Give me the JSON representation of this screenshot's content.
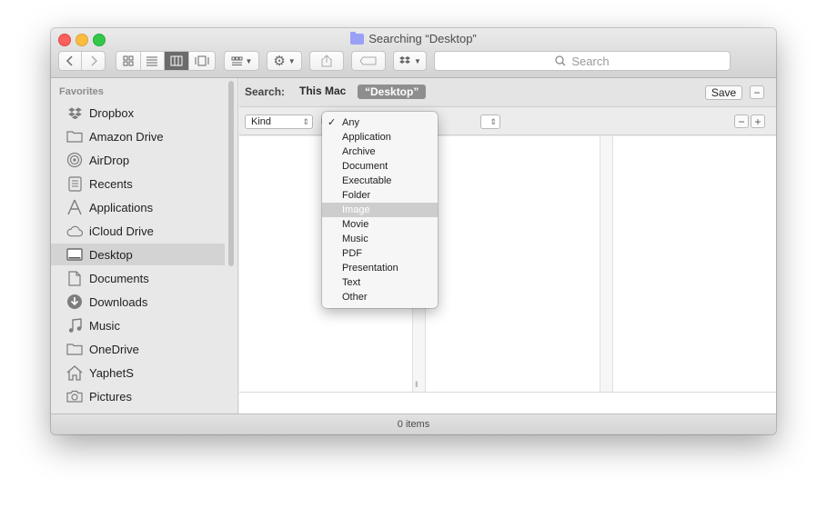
{
  "window": {
    "title": "Searching “Desktop”",
    "status": "0 items"
  },
  "toolbar": {
    "back_icon": "chevron-left-icon",
    "forward_icon": "chevron-right-icon",
    "view_modes": [
      "icon-view-icon",
      "list-view-icon",
      "column-view-icon",
      "gallery-view-icon"
    ],
    "active_view": "column-view-icon",
    "search_placeholder": "Search"
  },
  "sidebar": {
    "header": "Favorites",
    "items": [
      {
        "label": "Dropbox",
        "icon": "dropbox-icon"
      },
      {
        "label": "Amazon Drive",
        "icon": "folder-icon"
      },
      {
        "label": "AirDrop",
        "icon": "airdrop-icon"
      },
      {
        "label": "Recents",
        "icon": "recents-icon"
      },
      {
        "label": "Applications",
        "icon": "applications-icon"
      },
      {
        "label": "iCloud Drive",
        "icon": "cloud-icon"
      },
      {
        "label": "Desktop",
        "icon": "desktop-icon",
        "selected": true
      },
      {
        "label": "Documents",
        "icon": "document-icon"
      },
      {
        "label": "Downloads",
        "icon": "download-icon"
      },
      {
        "label": "Music",
        "icon": "music-icon"
      },
      {
        "label": "OneDrive",
        "icon": "folder-icon"
      },
      {
        "label": "YaphetS",
        "icon": "home-icon"
      },
      {
        "label": "Pictures",
        "icon": "camera-icon"
      }
    ]
  },
  "search": {
    "label": "Search:",
    "scope_mac": "This Mac",
    "scope_desktop": "“Desktop”",
    "save_label": "Save",
    "minus": "−",
    "plus": "+"
  },
  "criteria": {
    "attribute": "Kind",
    "operator_partial": "i"
  },
  "kind_menu": {
    "selected": "Any",
    "highlighted": "Image",
    "options": [
      "Any",
      "Application",
      "Archive",
      "Document",
      "Executable",
      "Folder",
      "Image",
      "Movie",
      "Music",
      "PDF",
      "Presentation",
      "Text",
      "Other"
    ]
  }
}
